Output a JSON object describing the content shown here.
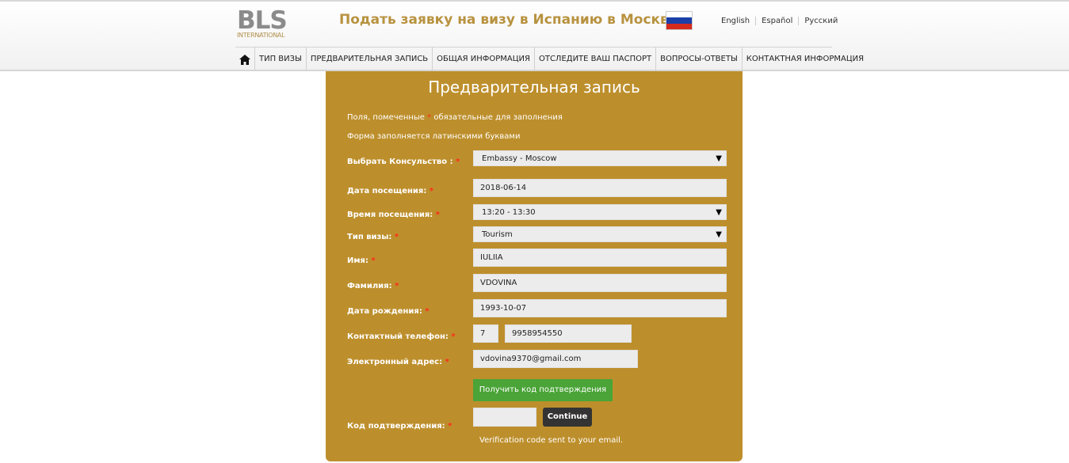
{
  "header": {
    "logo_main": "BLS",
    "logo_sub": "INTERNATIONAL",
    "title": "Подать заявку на визу в Испанию в Москве",
    "languages": [
      "English",
      "Español",
      "Русский"
    ]
  },
  "nav": {
    "items": [
      "Тип визы",
      "Предварительная запись",
      "Общая информация",
      "Отследите ваш паспорт",
      "Вопросы-ответы",
      "Контактная информация"
    ]
  },
  "form": {
    "title": "Предварительная запись",
    "note_required_prefix": "Поля, помеченные",
    "note_required_suffix": "обязательные для заполнения",
    "note_latin": "Форма заполняется латинскими буквами",
    "required_mark": "*",
    "consulate_label": "Выбрать Консульство :",
    "consulate_value": "Embassy - Moscow",
    "visit_date_label": "Дата посещения:",
    "visit_date_value": "2018-06-14",
    "visit_time_label": "Время посещения:",
    "visit_time_value": "13:20 - 13:30",
    "visa_type_label": "Тип визы:",
    "visa_type_value": "Tourism",
    "first_name_label": "Имя:",
    "first_name_value": "IULIIA",
    "last_name_label": "Фамилия:",
    "last_name_value": "VDOVINA",
    "birth_date_label": "Дата рождения:",
    "birth_date_value": "1993-10-07",
    "phone_label": "Контактный телефон:",
    "phone_code": "7",
    "phone_number": "9958954550",
    "email_label": "Электронный адрес:",
    "email_value": "vdovina9370@gmail.com",
    "get_code_button": "Получить код подтверждения",
    "code_label": "Код подтверждения:",
    "code_value": "",
    "continue_button": "Continue",
    "verification_message": "Verification code sent to your email."
  },
  "colors": {
    "panel": "#bd8f2c",
    "title_gold": "#b8923f",
    "required": "#ff2a1a",
    "green_button": "#4aa437",
    "dark_button": "#333333"
  }
}
